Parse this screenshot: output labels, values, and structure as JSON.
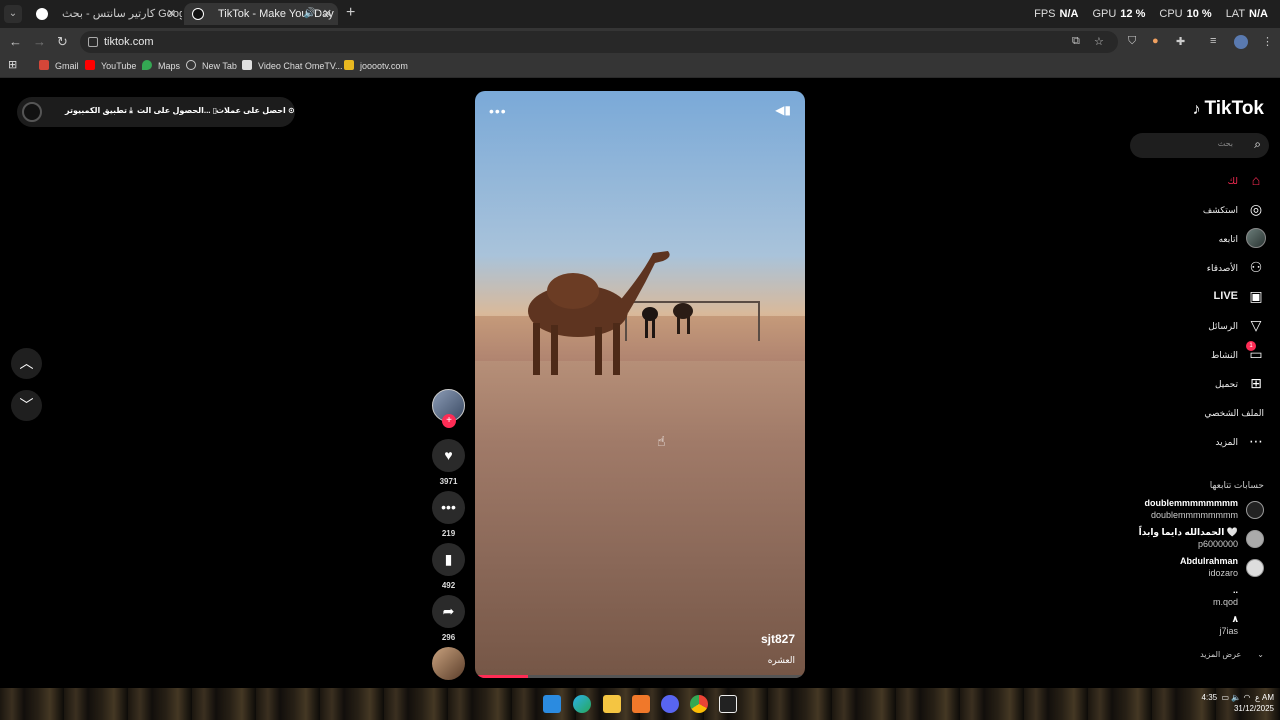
{
  "browser": {
    "tabs": [
      {
        "title": "كارتير سانتس - بحث Google",
        "active": false
      },
      {
        "title": "TikTok - Make Your Day",
        "active": true
      }
    ],
    "perf": [
      {
        "label": "FPS",
        "value": "N/A"
      },
      {
        "label": "GPU",
        "value": "12 %"
      },
      {
        "label": "CPU",
        "value": "10 %"
      },
      {
        "label": "LAT",
        "value": "N/A"
      }
    ],
    "url": "tiktok.com",
    "bookmarks": [
      "Gmail",
      "YouTube",
      "Maps",
      "New Tab",
      "Video Chat OmeTV...",
      "jooootv.com"
    ]
  },
  "topbar": {
    "get_coins": "احصل على عملات",
    "get_app": "الحصول على الت...",
    "pc_app": "تطبيق الكمبيوتر"
  },
  "video": {
    "username": "sjt827",
    "description": "العشره",
    "progress": 0.16
  },
  "actions": {
    "likes": "3971",
    "comments": "219",
    "saves": "492",
    "shares": "296"
  },
  "sidebar": {
    "logo": "TikTok",
    "search_placeholder": "بحث",
    "nav": [
      {
        "label": "لك",
        "icon": "home-icon",
        "active": true
      },
      {
        "label": "استكشف",
        "icon": "compass-icon"
      },
      {
        "label": "اتابعه",
        "icon": "following-avatar"
      },
      {
        "label": "الأصدقاء",
        "icon": "friends-icon"
      },
      {
        "label": "LIVE",
        "icon": "live-icon"
      },
      {
        "label": "الرسائل",
        "icon": "messages-icon"
      },
      {
        "label": "النشاط",
        "icon": "activity-icon",
        "badge": "1"
      },
      {
        "label": "تحميل",
        "icon": "upload-icon"
      },
      {
        "label": "الملف الشخصي",
        "icon": "profile-icon"
      },
      {
        "label": "المزيد",
        "icon": "more-icon"
      }
    ],
    "following_title": "حسابات تتابعها",
    "accounts": [
      {
        "name": "doublemmmmmmmm",
        "handle": "doublemmmmmmmm"
      },
      {
        "name": "الحمدالله دايما وابداً 🤍",
        "handle": "p6000000"
      },
      {
        "name": "Abdulrahman",
        "handle": "idozaro"
      },
      {
        "name": "..",
        "handle": "m.qod"
      },
      {
        "name": "۸",
        "handle": "j7ias"
      }
    ],
    "see_more": "عرض المزيد"
  },
  "taskbar": {
    "time": "4:35 AM",
    "date": "31/12/2025",
    "lang": "ع"
  }
}
